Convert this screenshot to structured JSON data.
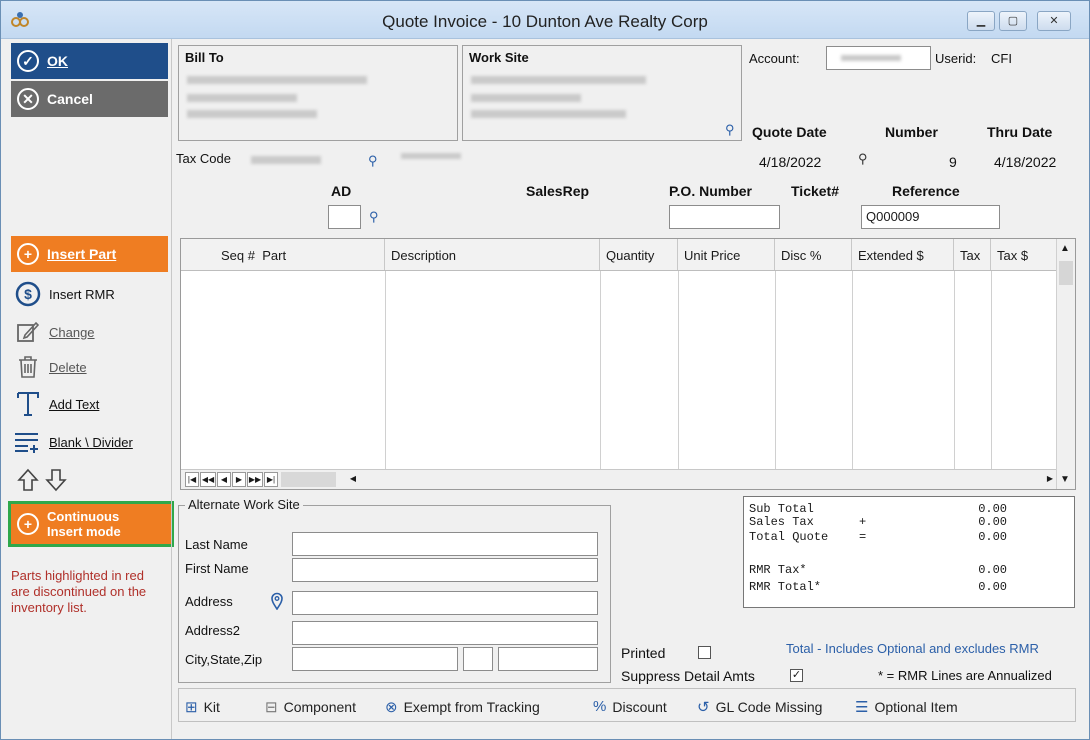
{
  "window": {
    "title": "Quote Invoice - 10 Dunton Ave Realty Corp"
  },
  "actions": {
    "ok": "OK",
    "cancel": "Cancel"
  },
  "tools": {
    "insert_part": "Insert Part",
    "insert_rmr": "Insert RMR",
    "change": "Change",
    "delete": "Delete",
    "add_text": "Add Text",
    "blank_divider": "Blank \\ Divider",
    "continuous_insert": "Continuous Insert mode"
  },
  "note": "Parts highlighted in red are discontinued on the inventory list.",
  "header": {
    "bill_to": "Bill To",
    "work_site": "Work Site",
    "account_label": "Account:",
    "userid_label": "Userid:",
    "userid_value": "CFI",
    "quote_date_label": "Quote Date",
    "number_label": "Number",
    "thru_date_label": "Thru Date",
    "quote_date": "4/18/2022",
    "number": "9",
    "thru_date": "4/18/2022",
    "tax_code_label": "Tax Code",
    "ad_label": "AD",
    "salesrep_label": "SalesRep",
    "po_label": "P.O. Number",
    "ticket_label": "Ticket#",
    "reference_label": "Reference",
    "reference_value": "Q000009"
  },
  "grid": {
    "columns": [
      "Seq #",
      "Part",
      "Description",
      "Quantity",
      "Unit Price",
      "Disc %",
      "Extended $",
      "Tax",
      "Tax $"
    ]
  },
  "alt_site": {
    "legend": "Alternate Work Site",
    "last_name": "Last Name",
    "first_name": "First Name",
    "address": "Address",
    "address2": "Address2",
    "city_state_zip": "City,State,Zip"
  },
  "totals": {
    "sub_total": "Sub Total",
    "sales_tax": "Sales Tax",
    "sales_tax_sym": "+",
    "total_quote": "Total Quote",
    "total_quote_sym": "=",
    "rmr_tax": "RMR Tax*",
    "rmr_total": "RMR Total*",
    "v_sub": "0.00",
    "v_tax": "0.00",
    "v_total": "0.00",
    "v_rmr_tax": "0.00",
    "v_rmr_total": "0.00"
  },
  "options": {
    "printed": "Printed",
    "suppress": "Suppress Detail Amts",
    "total_note": "Total - Includes Optional and excludes RMR",
    "rmr_note": "* = RMR Lines are Annualized"
  },
  "legend_bar": {
    "kit": "Kit",
    "component": "Component",
    "exempt": "Exempt from Tracking",
    "discount": "Discount",
    "gl_code": "GL Code Missing",
    "optional": "Optional Item"
  },
  "colors": {
    "ok_blue": "#1f4e8a",
    "orange": "#ef7d22",
    "note_red": "#b0302a",
    "highlight_green": "#2fa84a"
  }
}
